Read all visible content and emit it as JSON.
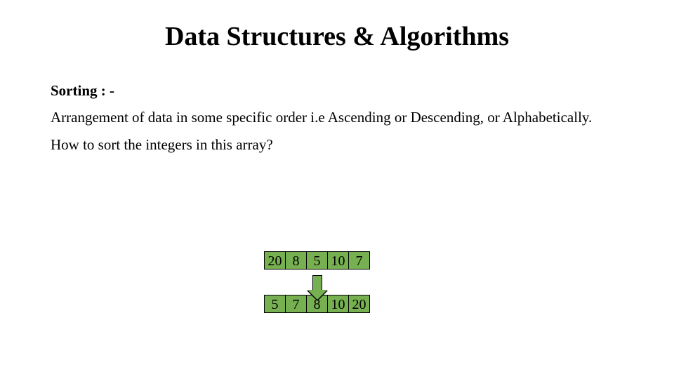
{
  "title": "Data Structures & Algorithms",
  "section_heading": "Sorting : -",
  "definition": "Arrangement of data in some specific order i.e Ascending or Descending, or Alphabetically.",
  "question": "How to sort the integers in this array?",
  "array_unsorted": [
    "20",
    "8",
    "5",
    "10",
    "7"
  ],
  "array_sorted": [
    "5",
    "7",
    "8",
    "10",
    "20"
  ],
  "colors": {
    "cell_fill": "#77b050",
    "cell_border": "#000000"
  }
}
